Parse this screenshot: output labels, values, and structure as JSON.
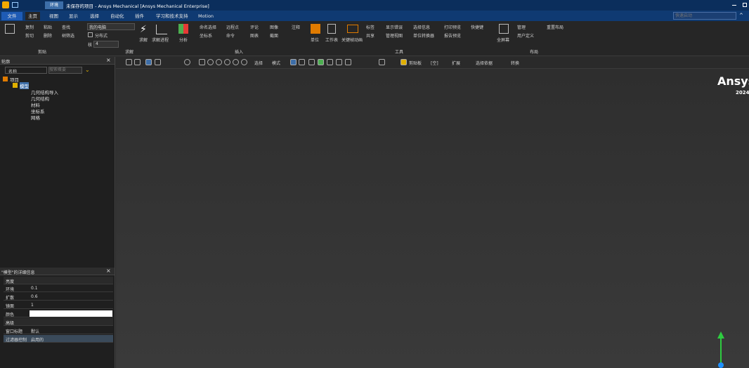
{
  "titlebar": {
    "title_tab": "环境",
    "window_title": "未保存的项目 - Ansys Mechanical [Ansys Mechanical Enterprise]"
  },
  "menubar": {
    "file": "文件",
    "tabs": [
      "主页",
      "视图",
      "显示",
      "选择",
      "自动化",
      "插件",
      "学习和技术支持",
      "Motion"
    ],
    "search_placeholder": "快速启动"
  },
  "ribbon": {
    "group_labels": [
      "剪贴",
      "求解",
      "插入",
      "工具",
      "布局"
    ],
    "copy": "复制",
    "paste": "粘贴",
    "cut": "剪切",
    "delete": "删除",
    "find": "查找",
    "tree_filter": "树筛选",
    "solver": "我的电脑",
    "distributed": "分布式",
    "cores_label": "核",
    "cores": "4",
    "solve": "求解",
    "solve_process": "求解进程",
    "analysis": "分析",
    "named_sel": "命名选择",
    "remote_point": "远程点",
    "comment": "评论",
    "image": "图像",
    "annotation": "注释",
    "coord_sys": "坐标系",
    "command": "命令",
    "chart": "图表",
    "section": "截面",
    "units": "单位",
    "worksheet": "工作表",
    "keyframe": "关键帧动画",
    "tags": "标签",
    "show_errors": "显示错误",
    "select_info": "选择信息",
    "print_preview": "打印预览",
    "shortcut": "快捷键",
    "common": "共享",
    "manage_views": "管理视图",
    "unit_converter": "单位转换器",
    "report_preview": "报告预览",
    "fullscreen": "全屏幕",
    "manage": "管理",
    "user_defined": "用户定义",
    "reset_layout": "重置布局"
  },
  "toolbar": {
    "select": "选择",
    "mode": "模式",
    "clipboard": "剪贴板",
    "empty": "[空]",
    "expand": "扩展",
    "select_tree": "选择依据",
    "convert": "转换"
  },
  "outline": {
    "title": "轮廓",
    "name_label": "名称",
    "search_placeholder": "搜索概要",
    "nodes": [
      "项目",
      "模型",
      "几何结构导入",
      "几何结构",
      "材料",
      "坐标系",
      "网格"
    ]
  },
  "details": {
    "title": "\"模型\"的详细信息",
    "section1": "亮度",
    "rows": [
      {
        "k": "环境",
        "v": "0.1"
      },
      {
        "k": "扩散",
        "v": "0.6"
      },
      {
        "k": "镜面",
        "v": "1"
      },
      {
        "k": "颜色",
        "v": ""
      }
    ],
    "section2": "高级",
    "rows2": [
      {
        "k": "窗口标题",
        "v": "默认"
      },
      {
        "k": "过滤器控制",
        "v": "启用的"
      }
    ]
  },
  "viewport": {
    "brand": "Ansys",
    "version": "2024"
  },
  "colors": {
    "accent": "#0f3a72",
    "title": "#0b2e5c",
    "axis_y": "#2ecc40",
    "axis_z": "#1e90ff"
  }
}
